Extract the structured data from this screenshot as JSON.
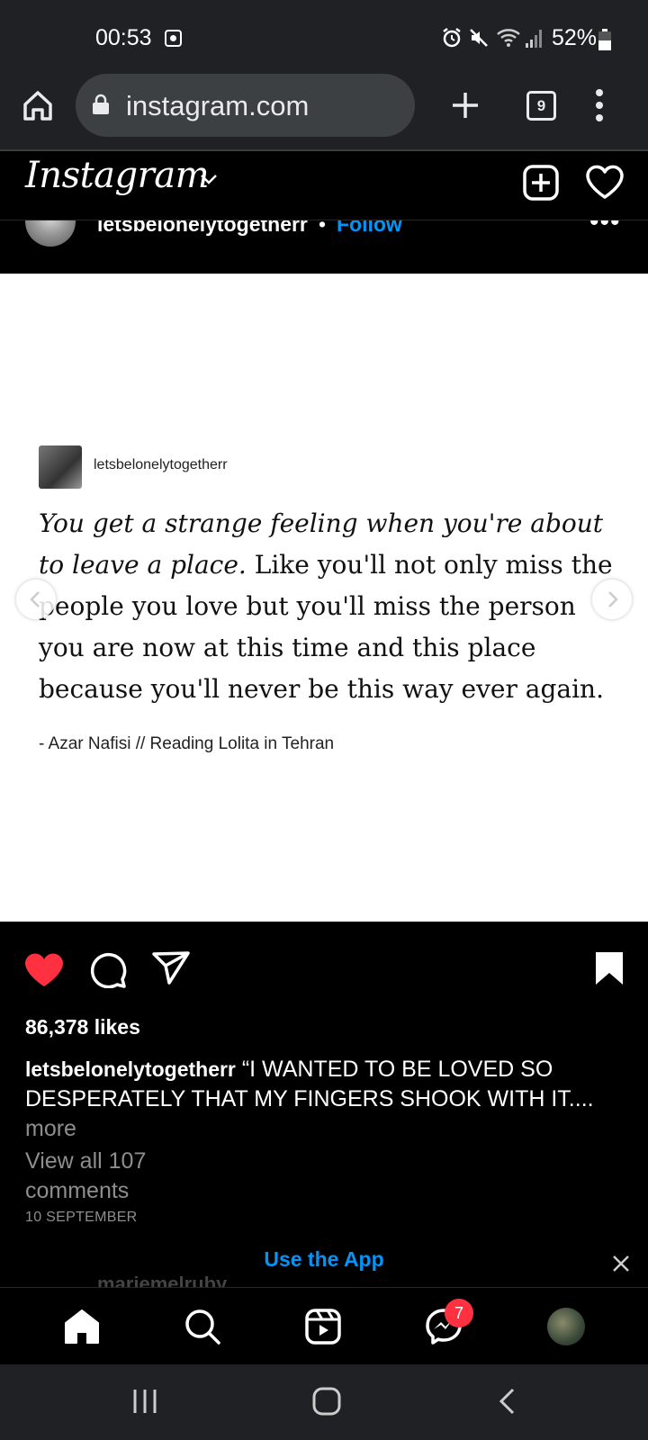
{
  "status_bar": {
    "time": "00:53",
    "battery": "52%",
    "icons": [
      "screen-record-icon",
      "alarm-icon",
      "mute-icon",
      "wifi-icon",
      "signal-icon",
      "battery-icon"
    ]
  },
  "browser": {
    "url": "instagram.com",
    "tab_count": "9",
    "icons": [
      "home-icon",
      "lock-icon",
      "new-tab-icon",
      "more-vertical-icon"
    ]
  },
  "ig_header": {
    "logo": "Instagram",
    "icons": [
      "chevron-down-icon",
      "new-post-icon",
      "heart-icon"
    ]
  },
  "post": {
    "author": "letsbelonelytogetherr",
    "separator": "•",
    "follow": "Follow",
    "more": "•••",
    "image": {
      "author": "letsbelonelytogetherr",
      "quote_italic": "You get a strange feeling when you're about to leave a place.",
      "quote_rest": " Like you'll not only miss the people you love but you'll miss the person you are now at this time and this place because you'll never be this way ever again.",
      "citation": "- Azar Nafisi // Reading Lolita in Tehran"
    },
    "likes": "86,378 likes",
    "caption_user": "letsbelonelytogetherr",
    "caption_text": " “I WANTED TO BE LOVED SO DESPERATELY THAT MY FINGERS SHOOK WITH IT....",
    "caption_more": "more",
    "view_comments": "View all 107 comments",
    "date": "10 SEPTEMBER",
    "next_comment_user": "mariemelruby"
  },
  "use_app": {
    "label": "Use the App"
  },
  "bottom_nav": {
    "messenger_badge": "7",
    "icons": [
      "home-icon",
      "search-icon",
      "reels-icon",
      "messenger-icon",
      "profile-avatar"
    ]
  },
  "colors": {
    "accent_blue": "#0095f6",
    "like_red": "#ff3040",
    "chrome_dark": "#202124"
  }
}
